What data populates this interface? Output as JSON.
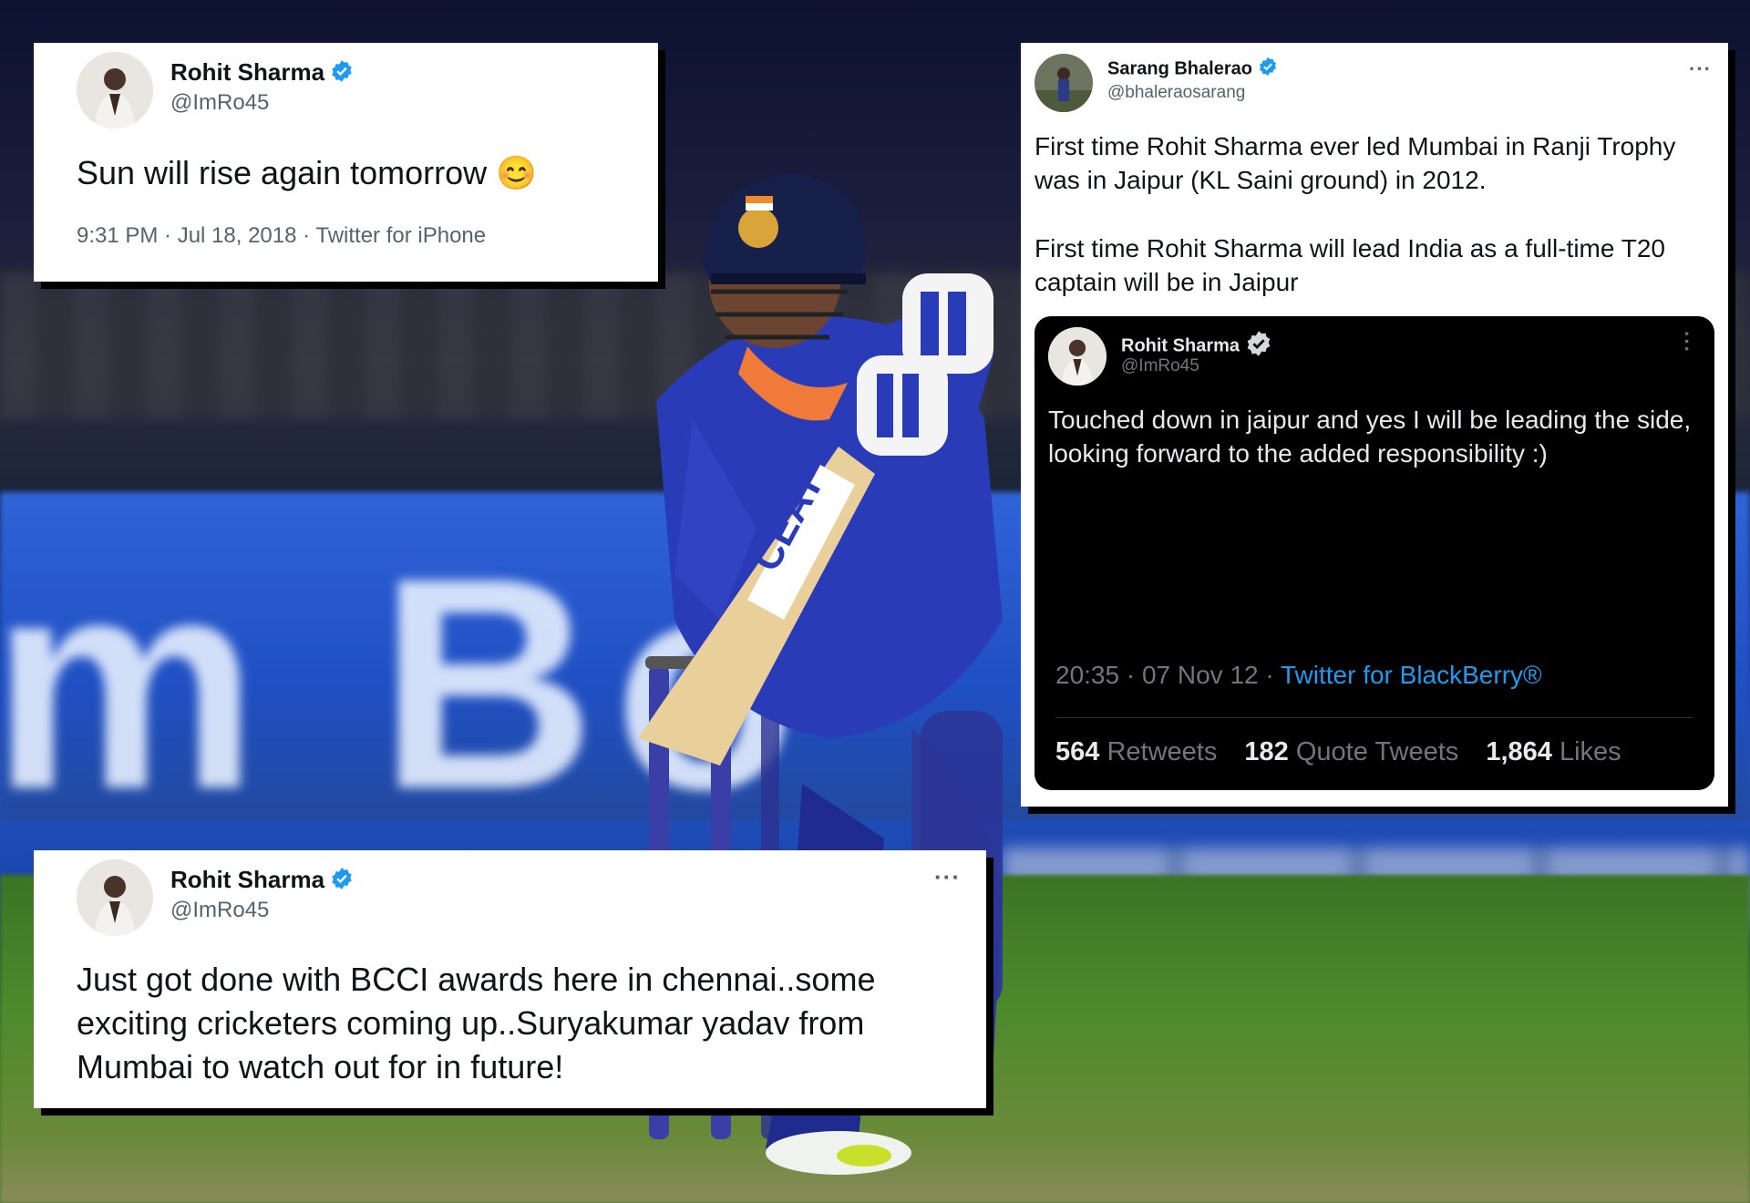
{
  "background": {
    "board_text": "m Bo",
    "bat_brand": "CEAT"
  },
  "tweet1": {
    "name": "Rohit Sharma",
    "handle": "@ImRo45",
    "text": "Sun will rise again tomorrow 😊",
    "meta": "9:31 PM · Jul 18, 2018 · Twitter for iPhone"
  },
  "tweet2": {
    "name": "Sarang Bhalerao",
    "handle": "@bhaleraosarang",
    "text_p1": "First time Rohit Sharma ever led Mumbai in Ranji Trophy was in Jaipur (KL Saini ground) in 2012.",
    "text_p2": "First time Rohit Sharma will lead India as a full-time T20 captain will be in Jaipur",
    "quoted": {
      "name": "Rohit Sharma",
      "handle": "@ImRo45",
      "text": "Touched down in jaipur and yes I will be leading the side, looking forward to the added responsibility :)",
      "meta_time": "20:35 · 07 Nov 12 · ",
      "meta_source": "Twitter for BlackBerry®",
      "retweets": "564",
      "retweets_label": "Retweets",
      "quotes": "182",
      "quotes_label": "Quote Tweets",
      "likes": "1,864",
      "likes_label": "Likes"
    }
  },
  "tweet3": {
    "name": "Rohit Sharma",
    "handle": "@ImRo45",
    "text": "Just got done with BCCI awards here in chennai..some exciting cricketers coming up..Suryakumar yadav from Mumbai to watch out for in future!"
  },
  "colors": {
    "verified": "#1d9bf0",
    "jersey": "#2a3bb8",
    "card_shadow": "#000000"
  }
}
